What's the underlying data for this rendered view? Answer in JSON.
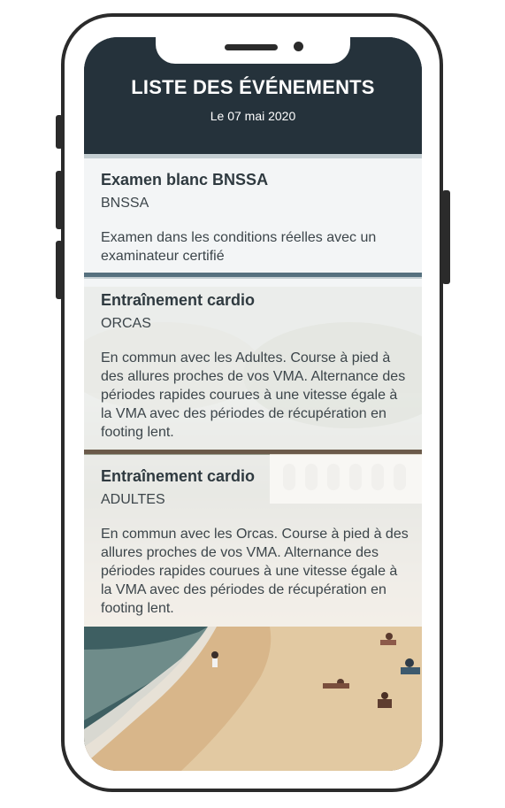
{
  "header": {
    "title": "LISTE DES ÉVÉNEMENTS",
    "date": "Le 07 mai 2020"
  },
  "events": [
    {
      "title": "Examen blanc BNSSA",
      "group": "BNSSA",
      "description": "Examen dans les conditions réelles avec un examinateur certifié"
    },
    {
      "title": "Entraînement cardio",
      "group": "ORCAS",
      "description": "En commun avec les Adultes. Course à pied à des allures proches de vos VMA. Alternance des périodes rapides courues à une vitesse égale à la VMA avec des périodes de récupération en footing lent."
    },
    {
      "title": "Entraînement cardio",
      "group": "ADULTES",
      "description": "En commun avec les Orcas. Course à pied à des allures proches de vos VMA. Alternance des périodes rapides courues à une vitesse égale à la VMA avec des périodes de récupération en footing lent."
    }
  ],
  "colors": {
    "header_bg": "#25323b",
    "card_text": "#2f3a40",
    "phone_frame": "#2b2b2b"
  },
  "icons": [
    "speaker-grille",
    "front-camera"
  ]
}
